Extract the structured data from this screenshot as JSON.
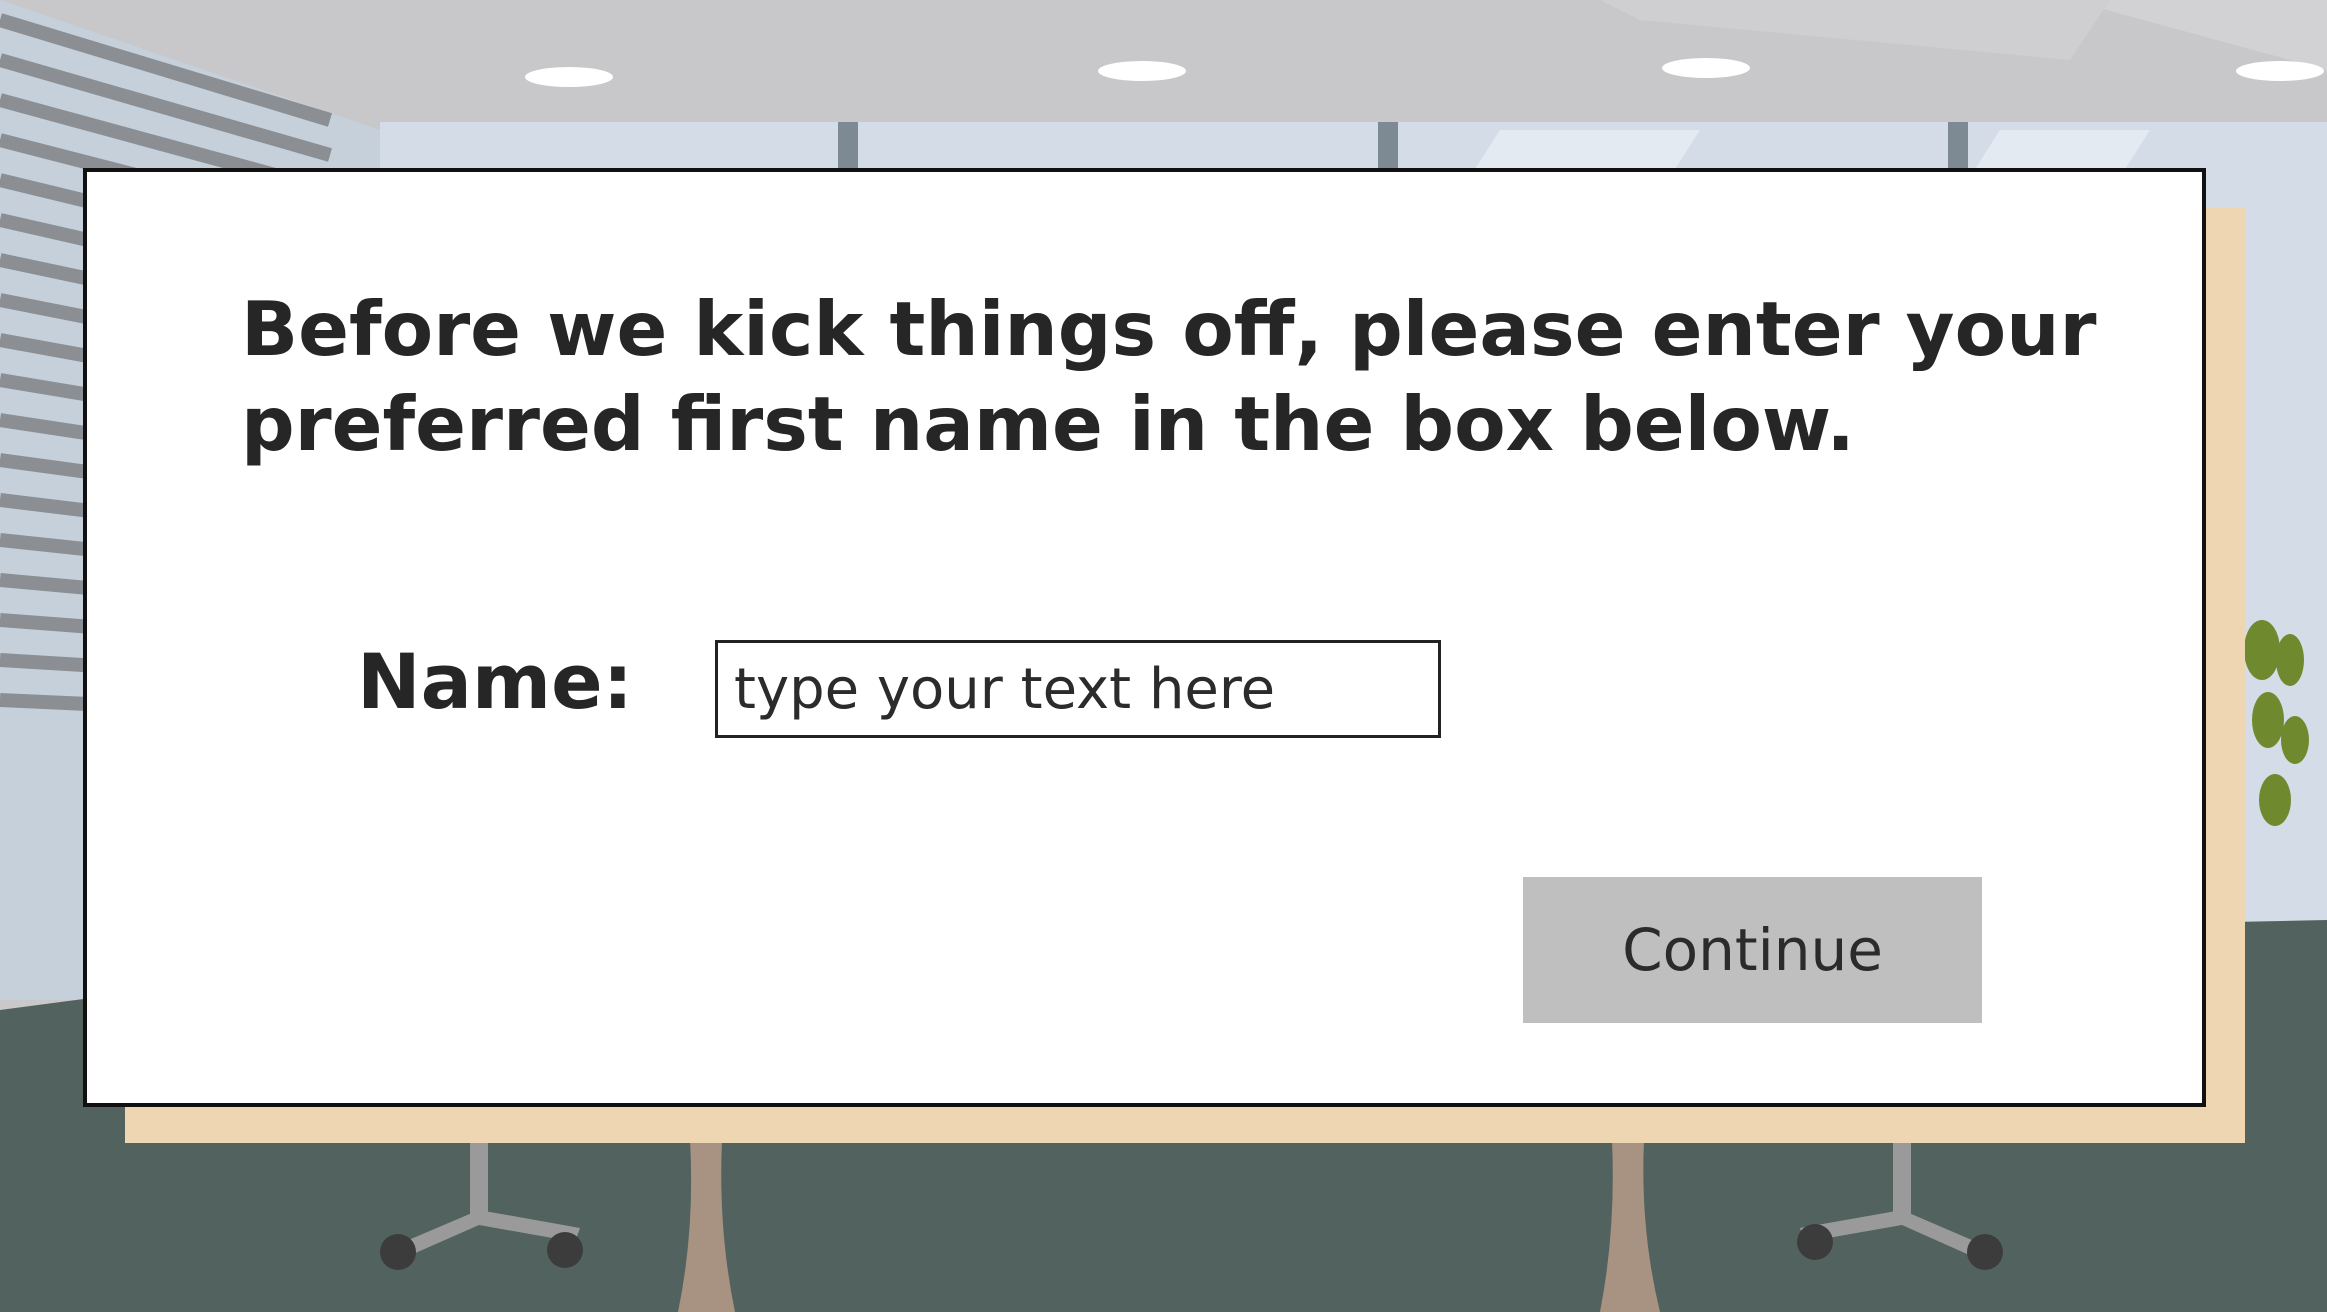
{
  "dialog": {
    "prompt": "Before we kick things off, please enter your preferred first name in the box below.",
    "name_label": "Name:",
    "name_input": {
      "value": "",
      "placeholder": "type your text here"
    },
    "continue_label": "Continue"
  },
  "colors": {
    "card_background": "#ffffff",
    "card_border": "#111111",
    "card_shadow": "#efd6b2",
    "button_background": "#bfbfbf",
    "text": "#262626",
    "floor": "#52625f",
    "ceiling": "#c9c9c9"
  }
}
